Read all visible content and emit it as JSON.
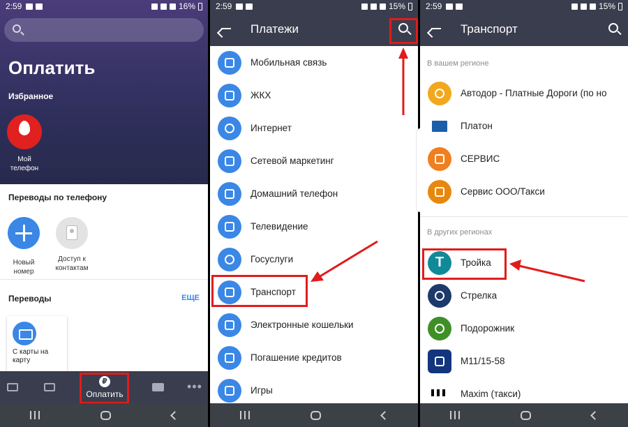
{
  "panel1": {
    "status": {
      "time": "2:59",
      "battery": "16%"
    },
    "title": "Оплатить",
    "favorites_title": "Избранное",
    "favorite_item": {
      "label": "Мой телефон"
    },
    "phone_transfers_title": "Переводы по телефону",
    "new_number_label": "Новый номер",
    "contacts_label": "Доступ к контактам",
    "transfers_title": "Переводы",
    "more_link": "ЕЩЕ",
    "card_to_card_label": "С карты на карту",
    "bottom_nav": {
      "pay_label": "Оплатить"
    }
  },
  "panel2": {
    "status": {
      "time": "2:59",
      "battery": "15%"
    },
    "title": "Платежи",
    "items": [
      {
        "label": "Мобильная связь",
        "icon": "mobile-phone-icon"
      },
      {
        "label": "ЖКХ",
        "icon": "house-icon"
      },
      {
        "label": "Интернет",
        "icon": "globe-icon"
      },
      {
        "label": "Сетевой маркетинг",
        "icon": "network-icon"
      },
      {
        "label": "Домашний телефон",
        "icon": "phone-handset-icon"
      },
      {
        "label": "Телевидение",
        "icon": "tv-icon"
      },
      {
        "label": "Госуслуги",
        "icon": "coat-of-arms-icon"
      },
      {
        "label": "Транспорт",
        "icon": "bus-icon"
      },
      {
        "label": "Электронные кошельки",
        "icon": "wallet-icon"
      },
      {
        "label": "Погашение кредитов",
        "icon": "credit-card-icon"
      },
      {
        "label": "Игры",
        "icon": "gamepad-icon"
      }
    ]
  },
  "panel3": {
    "status": {
      "time": "2:59",
      "battery": "15%"
    },
    "title": "Транспорт",
    "region_header": "В вашем регионе",
    "region_items": [
      {
        "label": "Автодор - Платные Дороги (по но",
        "icon": "avtodor-logo-icon"
      },
      {
        "label": "Платон",
        "icon": "platon-logo-icon"
      },
      {
        "label": "СЕРВИС",
        "icon": "bus-icon"
      },
      {
        "label": "Сервис ООО/Такси",
        "icon": "bus-icon"
      }
    ],
    "other_header": "В других регионах",
    "other_items": [
      {
        "label": "Тройка",
        "icon": "troika-logo-icon",
        "letter": "T"
      },
      {
        "label": "Стрелка",
        "icon": "strelka-logo-icon"
      },
      {
        "label": "Подорожник",
        "icon": "podorozhnik-logo-icon"
      },
      {
        "label": "М11/15-58",
        "icon": "m11-logo-icon"
      },
      {
        "label": "Maxim (такси)",
        "icon": "maxim-logo-icon"
      }
    ]
  },
  "colors": {
    "accent": "#3a87e6",
    "appbar": "#3a3d4d",
    "highlight": "#e21b1b"
  }
}
